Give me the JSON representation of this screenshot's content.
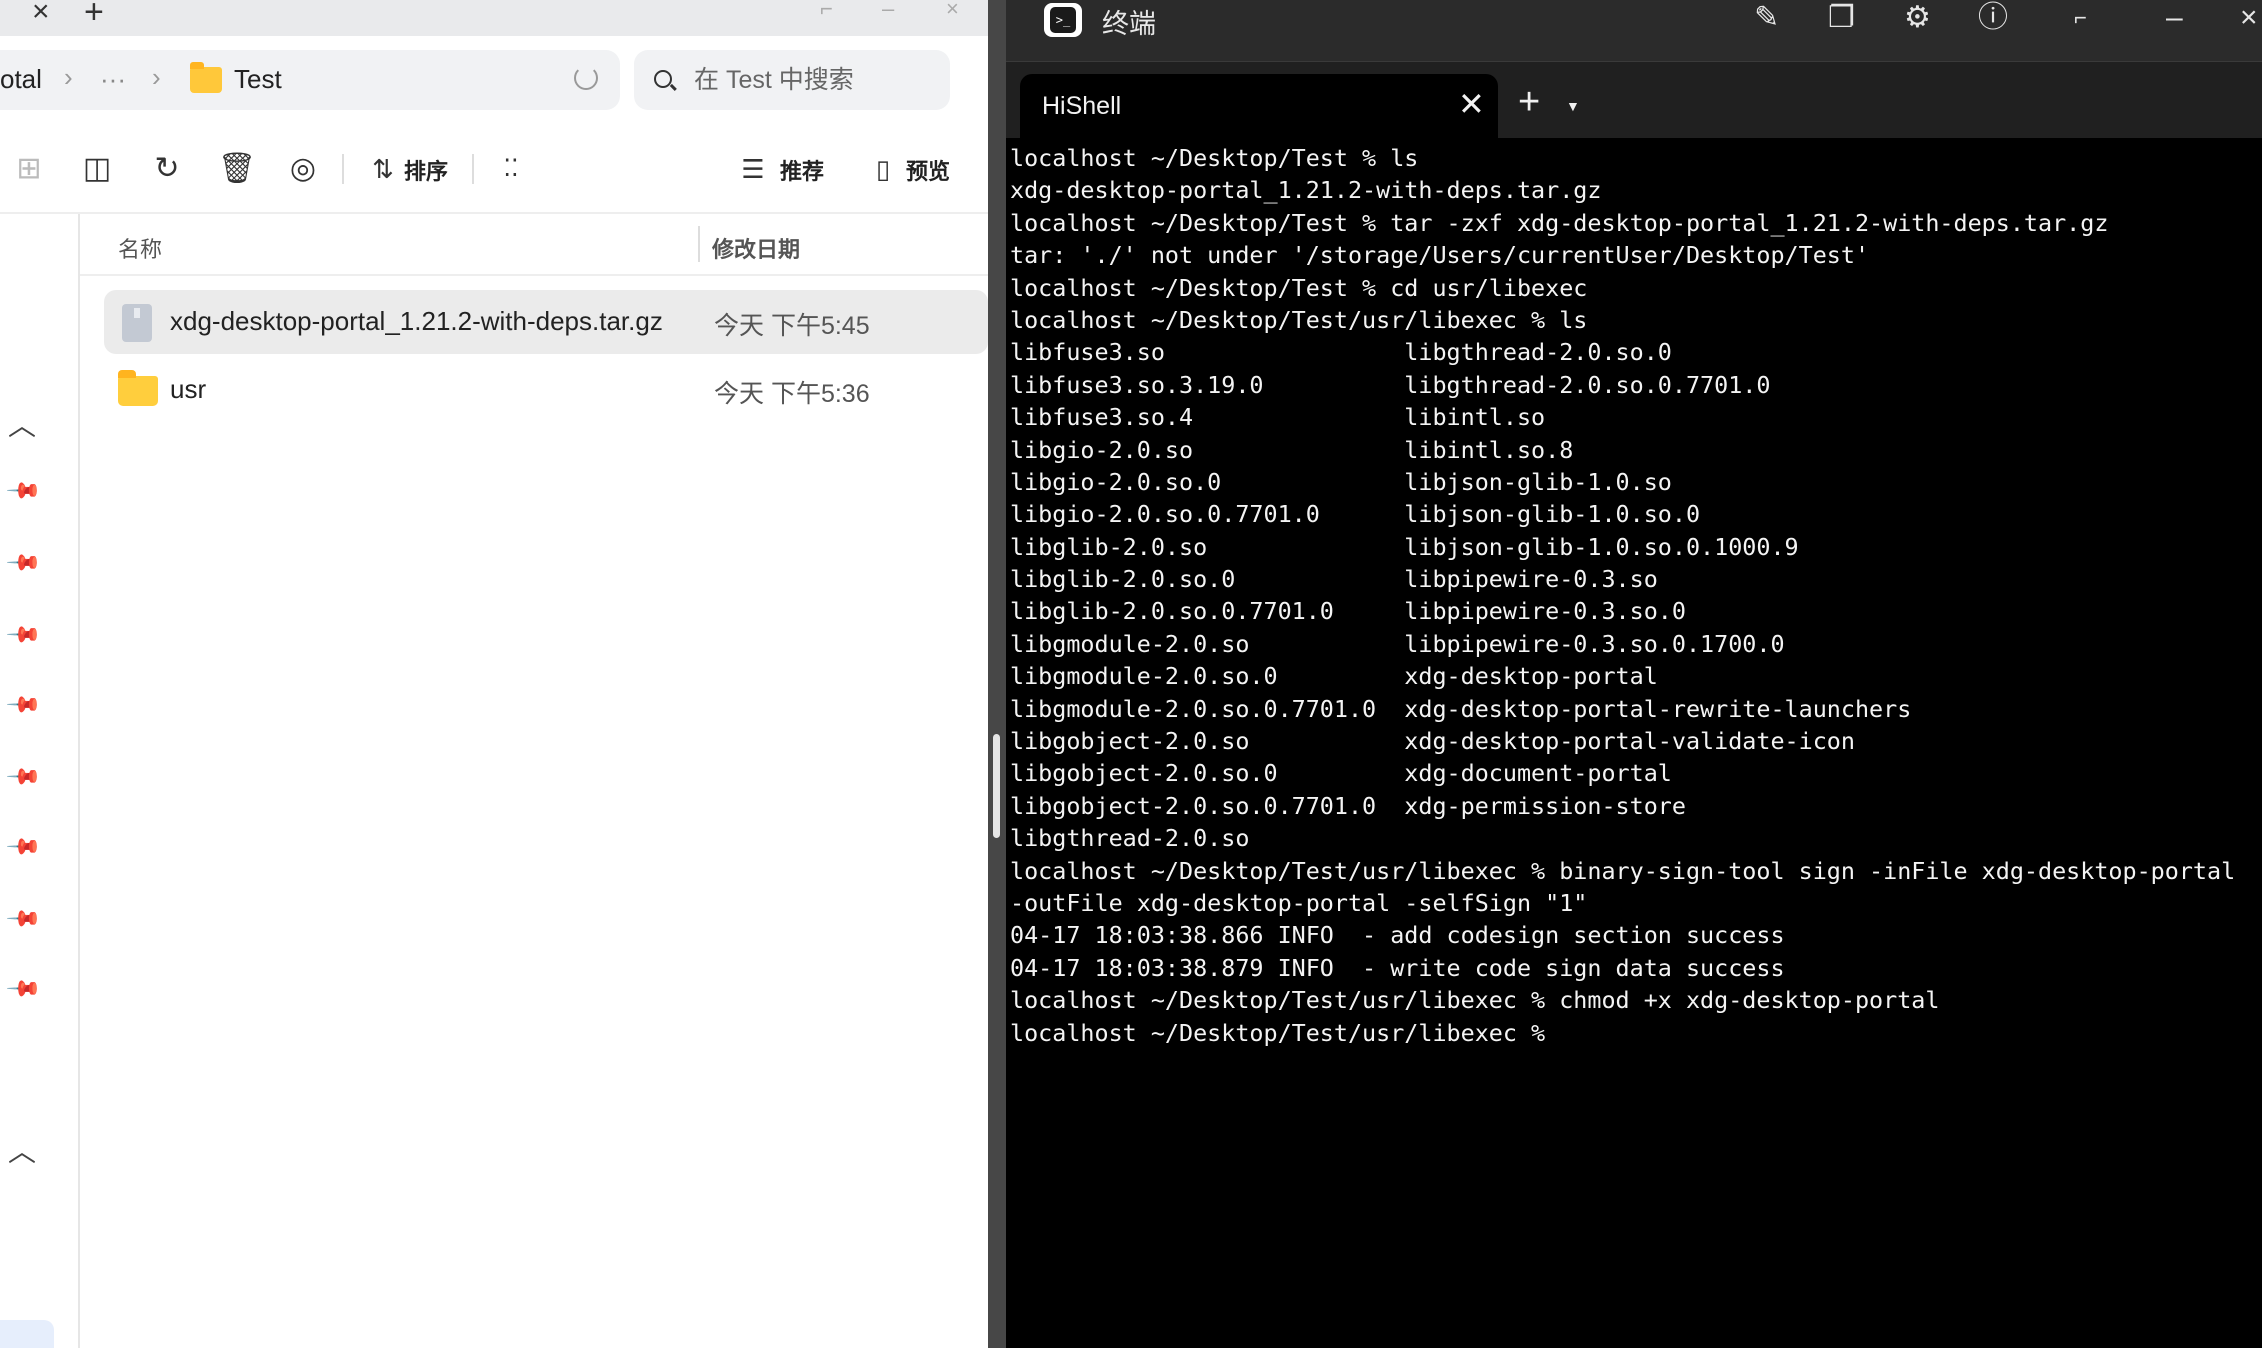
{
  "file_manager": {
    "address": {
      "partial_root": "otal",
      "ellipsis": "···",
      "current": "Test"
    },
    "search": {
      "placeholder": "在 Test 中搜索"
    },
    "toolbar": {
      "sort_label": "排序",
      "recommend_label": "推荐",
      "preview_label": "预览"
    },
    "columns": {
      "name": "名称",
      "modified": "修改日期"
    },
    "files": [
      {
        "name": "xdg-desktop-portal_1.21.2-with-deps.tar.gz",
        "modified": "今天 下午5:45",
        "type": "archive",
        "selected": true
      },
      {
        "name": "usr",
        "modified": "今天 下午5:36",
        "type": "folder",
        "selected": false
      }
    ]
  },
  "terminal": {
    "app_title": "终端",
    "tab_label": "HiShell",
    "lines": [
      "localhost ~/Desktop/Test % ls",
      "xdg-desktop-portal_1.21.2-with-deps.tar.gz",
      "localhost ~/Desktop/Test % tar -zxf xdg-desktop-portal_1.21.2-with-deps.tar.gz",
      "tar: './' not under '/storage/Users/currentUser/Desktop/Test'",
      "localhost ~/Desktop/Test % cd usr/libexec",
      "localhost ~/Desktop/Test/usr/libexec % ls",
      "libfuse3.so                 libgthread-2.0.so.0",
      "libfuse3.so.3.19.0          libgthread-2.0.so.0.7701.0",
      "libfuse3.so.4               libintl.so",
      "libgio-2.0.so               libintl.so.8",
      "libgio-2.0.so.0             libjson-glib-1.0.so",
      "libgio-2.0.so.0.7701.0      libjson-glib-1.0.so.0",
      "libglib-2.0.so              libjson-glib-1.0.so.0.1000.9",
      "libglib-2.0.so.0            libpipewire-0.3.so",
      "libglib-2.0.so.0.7701.0     libpipewire-0.3.so.0",
      "libgmodule-2.0.so           libpipewire-0.3.so.0.1700.0",
      "libgmodule-2.0.so.0         xdg-desktop-portal",
      "libgmodule-2.0.so.0.7701.0  xdg-desktop-portal-rewrite-launchers",
      "libgobject-2.0.so           xdg-desktop-portal-validate-icon",
      "libgobject-2.0.so.0         xdg-document-portal",
      "libgobject-2.0.so.0.7701.0  xdg-permission-store",
      "libgthread-2.0.so",
      "localhost ~/Desktop/Test/usr/libexec % binary-sign-tool sign -inFile xdg-desktop-portal",
      "-outFile xdg-desktop-portal -selfSign \"1\"",
      "04-17 18:03:38.866 INFO  - add codesign section success",
      "04-17 18:03:38.879 INFO  - write code sign data success",
      "localhost ~/Desktop/Test/usr/libexec % chmod +x xdg-desktop-portal",
      "localhost ~/Desktop/Test/usr/libexec %"
    ]
  },
  "colors": {
    "terminal_bg": "#000000",
    "terminal_text": "#f4f4f4",
    "file_selected_bg": "#ebebeb",
    "folder_yellow": "#ffce3d"
  }
}
